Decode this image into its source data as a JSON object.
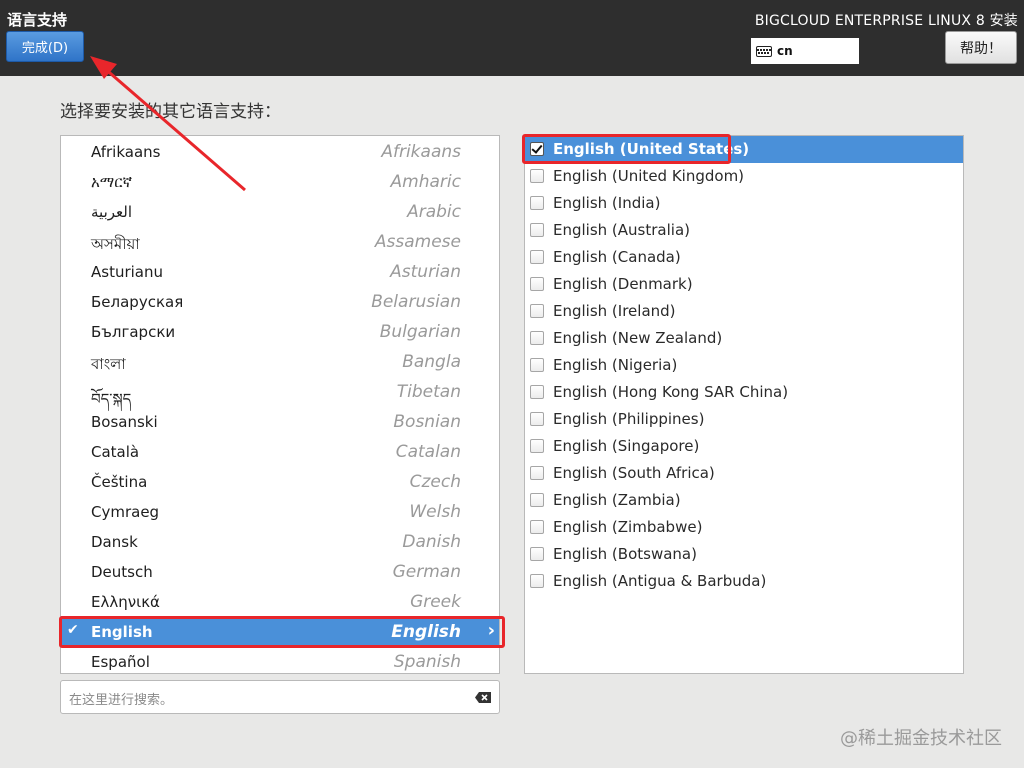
{
  "header": {
    "spoke_title": "语言支持",
    "done_label": "完成(D)",
    "product_title": "BIGCLOUD ENTERPRISE LINUX 8 安装",
    "keyboard_layout": "cn",
    "help_label": "帮助！"
  },
  "prompt": "选择要安装的其它语言支持：",
  "languages": [
    {
      "native": "Afrikaans",
      "english": "Afrikaans"
    },
    {
      "native": "አማርኛ",
      "english": "Amharic"
    },
    {
      "native": "العربية",
      "english": "Arabic"
    },
    {
      "native": "অসমীয়া",
      "english": "Assamese"
    },
    {
      "native": "Asturianu",
      "english": "Asturian"
    },
    {
      "native": "Беларуская",
      "english": "Belarusian"
    },
    {
      "native": "Български",
      "english": "Bulgarian"
    },
    {
      "native": "বাংলা",
      "english": "Bangla"
    },
    {
      "native": "བོད་སྐད",
      "english": "Tibetan"
    },
    {
      "native": "Bosanski",
      "english": "Bosnian"
    },
    {
      "native": "Català",
      "english": "Catalan"
    },
    {
      "native": "Čeština",
      "english": "Czech"
    },
    {
      "native": "Cymraeg",
      "english": "Welsh"
    },
    {
      "native": "Dansk",
      "english": "Danish"
    },
    {
      "native": "Deutsch",
      "english": "German"
    },
    {
      "native": "Ελληνικά",
      "english": "Greek"
    },
    {
      "native": "English",
      "english": "English"
    },
    {
      "native": "Español",
      "english": "Spanish"
    }
  ],
  "selected_language_index": 16,
  "search": {
    "placeholder": "在这里进行搜索。"
  },
  "locales": [
    {
      "label": "English (United States)",
      "checked": true
    },
    {
      "label": "English (United Kingdom)",
      "checked": false
    },
    {
      "label": "English (India)",
      "checked": false
    },
    {
      "label": "English (Australia)",
      "checked": false
    },
    {
      "label": "English (Canada)",
      "checked": false
    },
    {
      "label": "English (Denmark)",
      "checked": false
    },
    {
      "label": "English (Ireland)",
      "checked": false
    },
    {
      "label": "English (New Zealand)",
      "checked": false
    },
    {
      "label": "English (Nigeria)",
      "checked": false
    },
    {
      "label": "English (Hong Kong SAR China)",
      "checked": false
    },
    {
      "label": "English (Philippines)",
      "checked": false
    },
    {
      "label": "English (Singapore)",
      "checked": false
    },
    {
      "label": "English (South Africa)",
      "checked": false
    },
    {
      "label": "English (Zambia)",
      "checked": false
    },
    {
      "label": "English (Zimbabwe)",
      "checked": false
    },
    {
      "label": "English (Botswana)",
      "checked": false
    },
    {
      "label": "English (Antigua & Barbuda)",
      "checked": false
    }
  ],
  "watermark": "@稀土掘金技术社区",
  "colors": {
    "selection": "#4a90d9",
    "annotation": "#e8262b",
    "topbar": "#2e2e2e"
  },
  "icons": {
    "keyboard": "keyboard-icon",
    "clear": "clear-search-icon",
    "check": "checkmark-icon",
    "chevron": "chevron-right-icon"
  }
}
